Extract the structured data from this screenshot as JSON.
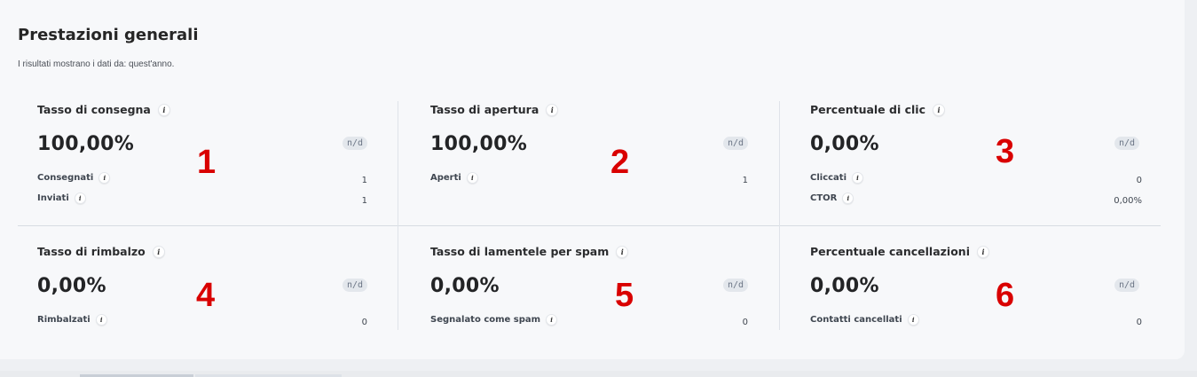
{
  "header": {
    "title": "Prestazioni generali",
    "subtitle": "I risultati mostrano i dati da: quest'anno."
  },
  "top_dots": "···",
  "info_glyph": "i",
  "metrics": [
    {
      "title": "Tasso di consegna",
      "value": "100,00%",
      "badge": "n/d",
      "annotation": "1",
      "rows": [
        {
          "label": "Consegnati",
          "value": "1"
        },
        {
          "label": "Inviati",
          "value": "1"
        }
      ]
    },
    {
      "title": "Tasso di apertura",
      "value": "100,00%",
      "badge": "n/d",
      "annotation": "2",
      "rows": [
        {
          "label": "Aperti",
          "value": "1"
        }
      ]
    },
    {
      "title": "Percentuale di clic",
      "value": "0,00%",
      "badge": "n/d",
      "annotation": "3",
      "rows": [
        {
          "label": "Cliccati",
          "value": "0"
        },
        {
          "label": "CTOR",
          "value": "0,00%"
        }
      ]
    },
    {
      "title": "Tasso di rimbalzo",
      "value": "0,00%",
      "badge": "n/d",
      "annotation": "4",
      "rows": [
        {
          "label": "Rimbalzati",
          "value": "0"
        }
      ]
    },
    {
      "title": "Tasso di lamentele per spam",
      "value": "0,00%",
      "badge": "n/d",
      "annotation": "5",
      "rows": [
        {
          "label": "Segnalato come spam",
          "value": "0"
        }
      ]
    },
    {
      "title": "Percentuale cancellazioni",
      "value": "0,00%",
      "badge": "n/d",
      "annotation": "6",
      "rows": [
        {
          "label": "Contatti cancellati",
          "value": "0"
        }
      ]
    }
  ],
  "colors": {
    "annotation": "#d90000",
    "badge_bg": "#e3e7ec",
    "card_bg": "#f7f8fa"
  }
}
